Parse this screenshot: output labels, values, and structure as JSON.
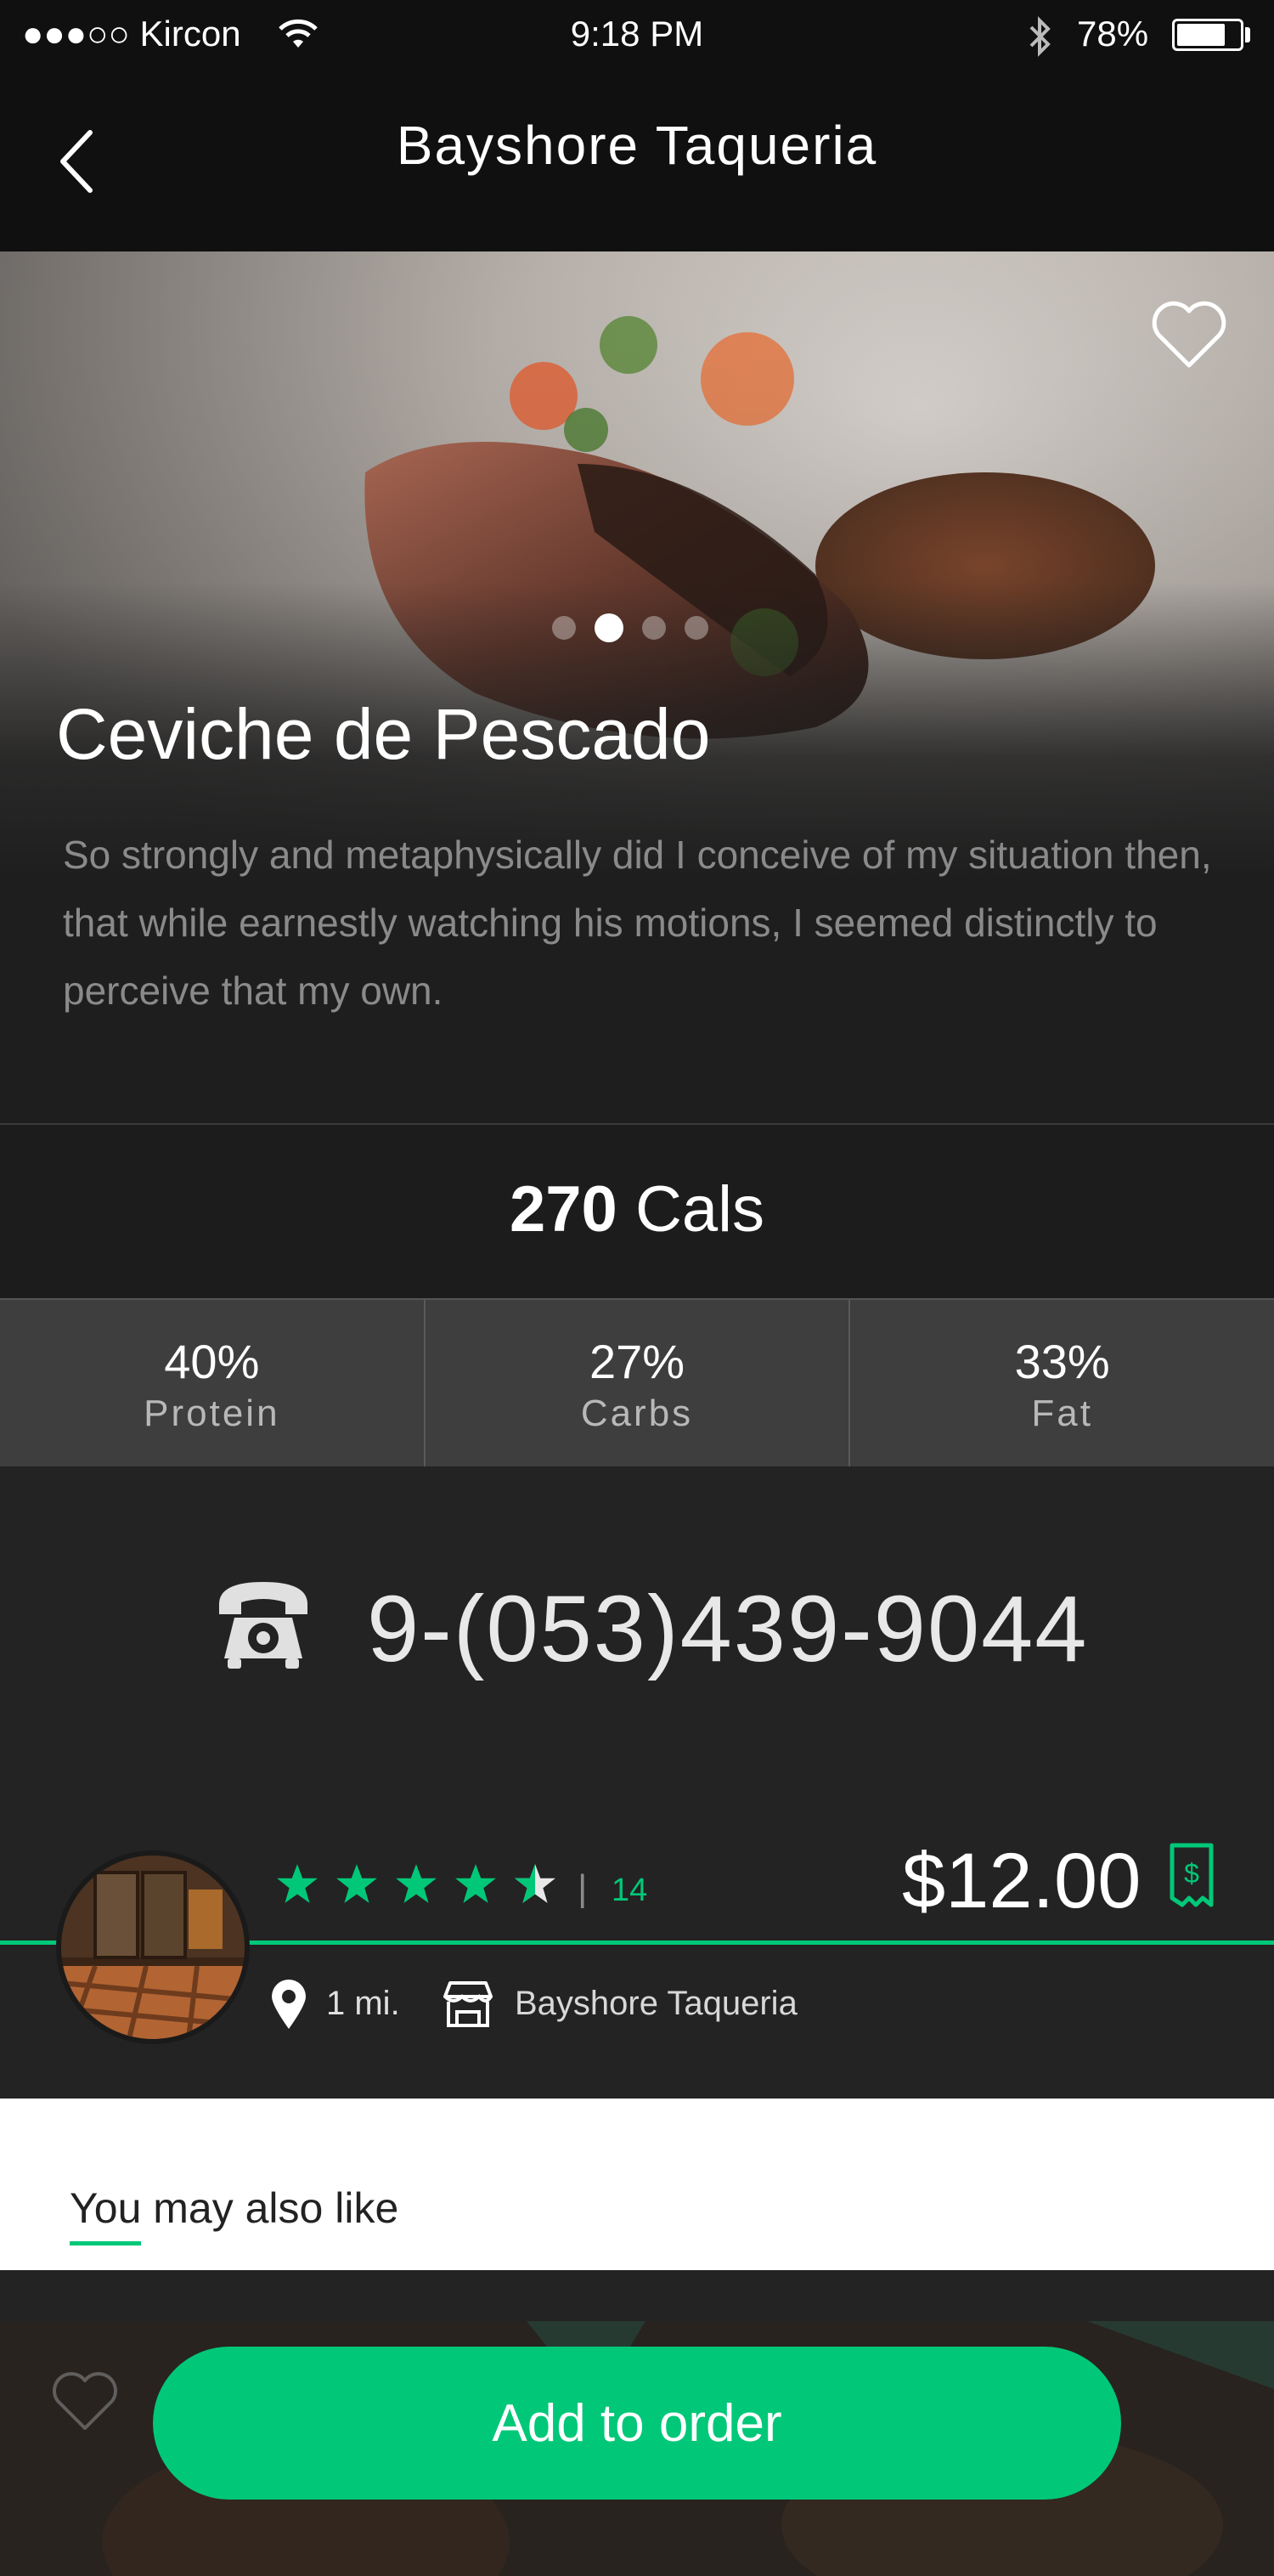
{
  "status_bar": {
    "carrier": "●●●○○ Kircon",
    "time": "9:18 PM",
    "battery": "78%",
    "battery_level": 0.78
  },
  "nav": {
    "title": "Bayshore Taqueria"
  },
  "dish": {
    "name": "Ceviche de Pescado",
    "description": "So strongly and metaphysically did I conceive of my situation then, that while earnestly watching his motions, I seemed distinctly to perceive that my own.",
    "carousel_total": 4,
    "carousel_active": 2
  },
  "nutrition": {
    "calories_value": "270",
    "calories_unit": "Cals",
    "macros": [
      {
        "pct": "40%",
        "label": "Protein"
      },
      {
        "pct": "27%",
        "label": "Carbs"
      },
      {
        "pct": "33%",
        "label": "Fat"
      }
    ]
  },
  "contact": {
    "phone": "9-(053)439-9044"
  },
  "restaurant": {
    "rating": 4.5,
    "rating_count": "14",
    "rating_separator": "|",
    "price": "$12.00",
    "distance": "1 mi.",
    "name": "Bayshore Taqueria"
  },
  "recommendations": {
    "label": "You may also like"
  },
  "actions": {
    "add_to_order": "Add to order"
  },
  "colors": {
    "accent": "#00c878",
    "background": "#1b1b1b",
    "header": "#101010"
  }
}
